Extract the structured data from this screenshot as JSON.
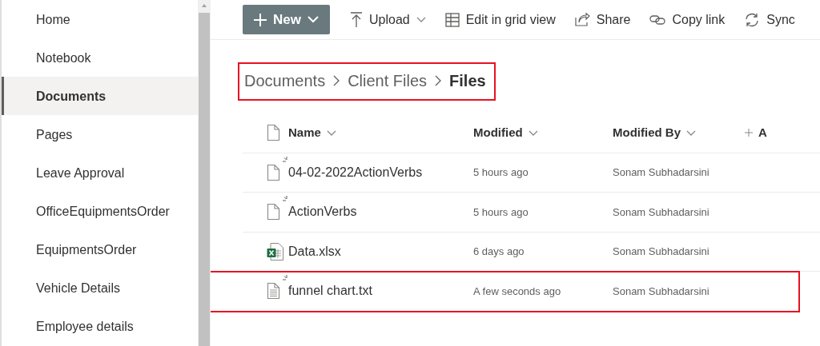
{
  "sidebar": {
    "items": [
      {
        "label": "Home",
        "selected": false
      },
      {
        "label": "Notebook",
        "selected": false
      },
      {
        "label": "Documents",
        "selected": true
      },
      {
        "label": "Pages",
        "selected": false
      },
      {
        "label": "Leave Approval",
        "selected": false
      },
      {
        "label": "OfficeEquipmentsOrder",
        "selected": false
      },
      {
        "label": "EquipmentsOrder",
        "selected": false
      },
      {
        "label": "Vehicle Details",
        "selected": false
      },
      {
        "label": "Employee details",
        "selected": false
      }
    ]
  },
  "toolbar": [
    {
      "kind": "new",
      "label": "New"
    },
    {
      "kind": "upload",
      "label": "Upload"
    },
    {
      "kind": "grid",
      "label": "Edit in grid view"
    },
    {
      "kind": "share",
      "label": "Share"
    },
    {
      "kind": "link",
      "label": "Copy link"
    },
    {
      "kind": "sync",
      "label": "Sync"
    }
  ],
  "breadcrumb": {
    "highlighted": true,
    "items": [
      "Documents",
      "Client Files",
      "Files"
    ]
  },
  "table": {
    "columns": [
      "Name",
      "Modified",
      "Modified By",
      "A"
    ],
    "rows": [
      {
        "kind": "file",
        "new": true,
        "name": "04-02-2022ActionVerbs",
        "modified": "5 hours ago",
        "modified_by": "Sonam Subhadarsini",
        "highlighted": false
      },
      {
        "kind": "file",
        "new": true,
        "name": "ActionVerbs",
        "modified": "5 hours ago",
        "modified_by": "Sonam Subhadarsini",
        "highlighted": false
      },
      {
        "kind": "excel",
        "new": false,
        "name": "Data.xlsx",
        "modified": "6 days ago",
        "modified_by": "Sonam Subhadarsini",
        "highlighted": false
      },
      {
        "kind": "text",
        "new": true,
        "name": "funnel chart.txt",
        "modified": "A few seconds ago",
        "modified_by": "Sonam Subhadarsini",
        "highlighted": true
      }
    ]
  }
}
